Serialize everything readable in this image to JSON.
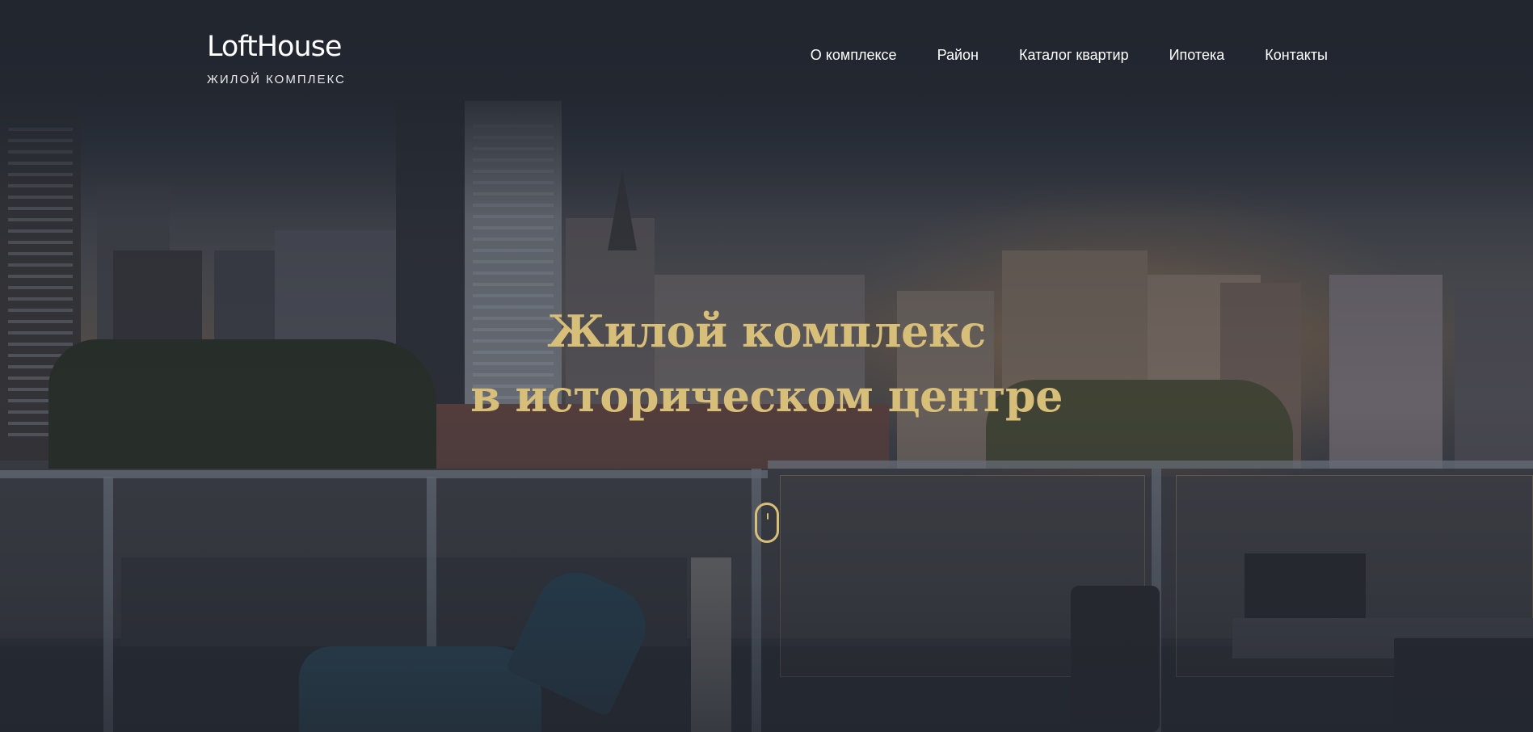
{
  "header": {
    "logo": {
      "title": "LoftHouse",
      "subtitle": "ЖИЛОЙ КОМПЛЕКС"
    },
    "nav": [
      {
        "label": "О комплексе"
      },
      {
        "label": "Район"
      },
      {
        "label": "Каталог квартир"
      },
      {
        "label": "Ипотека"
      },
      {
        "label": "Контакты"
      }
    ]
  },
  "hero": {
    "headline_line1": "Жилой комплекс",
    "headline_line2": "в историческом центре",
    "scroll_icon": "mouse-scroll-icon"
  },
  "colors": {
    "accent": "#d8bf79",
    "background": "#21262f",
    "text": "#ffffff"
  }
}
